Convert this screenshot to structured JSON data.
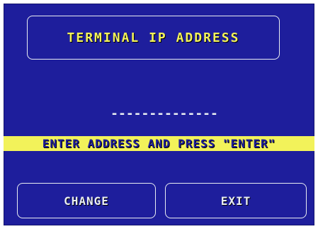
{
  "screen": {
    "title": "TERMINAL IP ADDRESS",
    "ip_placeholder": "--------------",
    "prompt": "ENTER ADDRESS AND PRESS \"ENTER\""
  },
  "buttons": {
    "change_label": "CHANGE",
    "exit_label": "EXIT"
  },
  "colors": {
    "background": "#1e1e9c",
    "accent_yellow": "#f2f25a",
    "outline": "#e9edf2",
    "frame": "#ffffff"
  }
}
